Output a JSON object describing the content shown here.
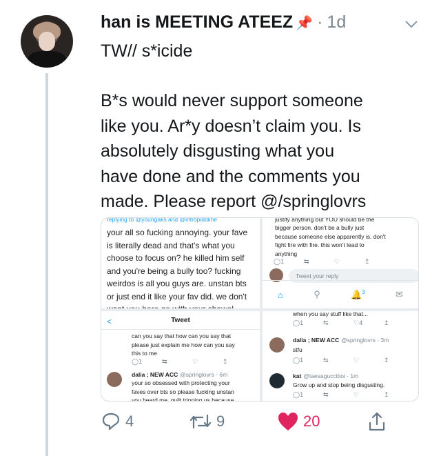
{
  "tweet": {
    "display_name": "han is MEETING ATEEZ",
    "timestamp": "1d",
    "separator": "·",
    "line1": "TW// s*icide",
    "body": "B*s would never support someone\nlike you. Ar*y doesn’t claim you. Is\nabsolutely disgusting what you\nhave done and the comments you\nmade. Please report @/springlovrs",
    "icons": {
      "menu": "chevron-down-icon",
      "pin": "pushpin-emoji"
    }
  },
  "embedded_screenshot": {
    "panel1": {
      "cut_top": "replying to @youngaks and @intropiddline",
      "text": "your all so fucking annoying. your fave\nis literally dead and that's what you\nchoose to focus on? he killed him self\nand you're being a bully too? fucking\nweirdos is all you guys are. unstan bts\nor just end it like your fav did. we don't\nwant you here go with your shawol"
    },
    "panel2": {
      "cut_top": "justify anything but YOU should be the",
      "text": "bigger person. don't be a bully just\nbecause someone else apparently is. don't\nfight fire with fire. this won't lead to\nanything",
      "reply_placeholder": "Tweet your reply",
      "notif_count": "3"
    },
    "panel3": {
      "back": "<",
      "title": "Tweet",
      "text": "can you say that how can you say that\nplease just explain me how can you say\nthis to me",
      "user_name": "dalia ; NEW ACC",
      "user_handle": "@springlovrs · 6m",
      "user_text": "your so obsessed with protecting your\nfaves over bts so please fucking unstan\nyou heard me, quilt tripping us because"
    },
    "panel4": {
      "cut_top": "when you say stuff like that...",
      "like_count": "4",
      "u1_name": "dalia ; NEW ACC",
      "u1_handle": "@springlovrs · 3m",
      "u1_text": "stfu",
      "u2_name": "kat",
      "u2_handle": "@taesagucciboi · 1m",
      "u2_text": "Grow up and stop being disgusting."
    }
  },
  "actions": {
    "reply_count": "4",
    "retweet_count": "9",
    "like_count": "20"
  },
  "colors": {
    "like": "#e0245e",
    "icon_grey": "#657786",
    "link_blue": "#1da1f2"
  }
}
